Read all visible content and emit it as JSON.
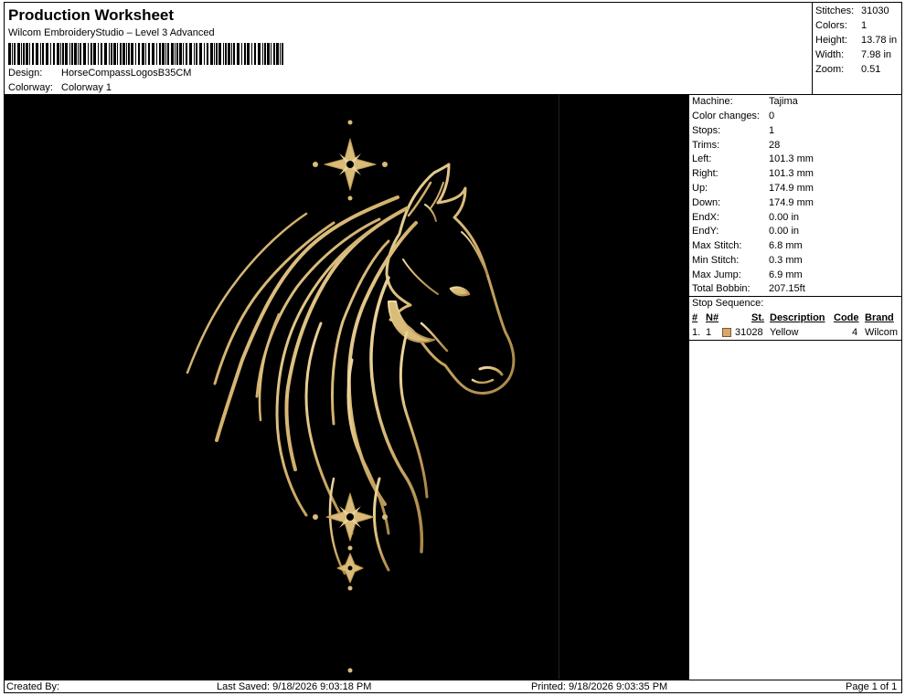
{
  "header": {
    "title": "Production Worksheet",
    "software": "Wilcom EmbroideryStudio – Level 3 Advanced",
    "design_label": "Design:",
    "design_value": "HorseCompassLogosB35CM",
    "colorway_label": "Colorway:",
    "colorway_value": "Colorway 1"
  },
  "summary": [
    {
      "label": "Stitches:",
      "value": "31030"
    },
    {
      "label": "Colors:",
      "value": "1"
    },
    {
      "label": "Height:",
      "value": "13.78 in"
    },
    {
      "label": "Width:",
      "value": "7.98 in"
    },
    {
      "label": "Zoom:",
      "value": "0.51"
    }
  ],
  "machine_info": [
    {
      "label": "Machine:",
      "value": "Tajima"
    },
    {
      "label": "Color changes:",
      "value": "0"
    },
    {
      "label": "Stops:",
      "value": "1"
    },
    {
      "label": "Trims:",
      "value": "28"
    },
    {
      "label": "Left:",
      "value": "101.3 mm"
    },
    {
      "label": "Right:",
      "value": "101.3 mm"
    },
    {
      "label": "Up:",
      "value": "174.9 mm"
    },
    {
      "label": "Down:",
      "value": "174.9 mm"
    },
    {
      "label": "EndX:",
      "value": "0.00 in"
    },
    {
      "label": "EndY:",
      "value": "0.00 in"
    },
    {
      "label": "Max Stitch:",
      "value": "6.8 mm"
    },
    {
      "label": "Min Stitch:",
      "value": "0.3 mm"
    },
    {
      "label": "Max Jump:",
      "value": "6.9 mm"
    },
    {
      "label": "Total Bobbin:",
      "value": "207.15ft"
    }
  ],
  "stop_sequence": {
    "title": "Stop Sequence:",
    "columns": [
      "#",
      "N#",
      "St.",
      "Description",
      "Code",
      "Brand"
    ],
    "rows": [
      {
        "num": "1.",
        "n": "1",
        "st": "31028",
        "description": "Yellow",
        "code": "4",
        "brand": "Wilcom",
        "color": "#d9a66b"
      }
    ]
  },
  "footer": {
    "created": "Created By:",
    "last_saved": "Last Saved: 9/18/2026 9:03:18 PM",
    "printed": "Printed: 9/18/2026 9:03:35 PM",
    "page": "Page 1 of 1"
  },
  "colors": {
    "thread": "#d9bb7a",
    "background": "#000000"
  }
}
